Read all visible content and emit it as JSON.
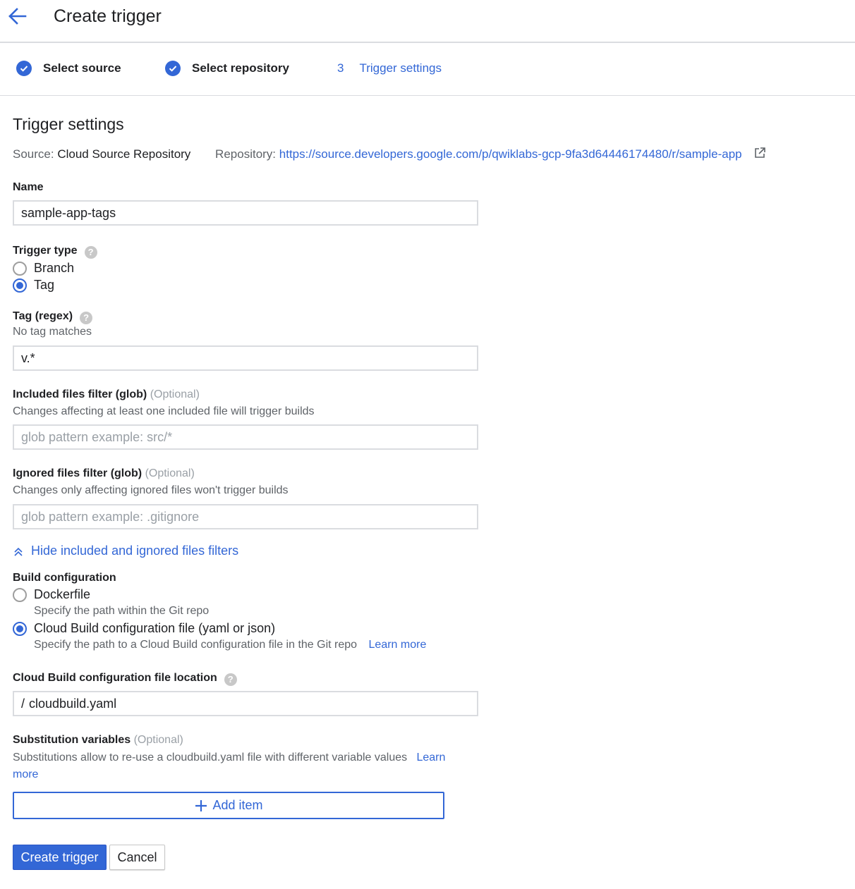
{
  "header": {
    "back_icon": "arrow-back-icon",
    "title": "Create trigger"
  },
  "stepper": {
    "steps": [
      {
        "label": "Select source",
        "state": "complete"
      },
      {
        "label": "Select repository",
        "state": "complete"
      },
      {
        "number": "3",
        "label": "Trigger settings",
        "state": "active"
      }
    ]
  },
  "settings": {
    "title": "Trigger settings",
    "source_label": "Source:",
    "source_value": "Cloud Source Repository",
    "repository_label": "Repository:",
    "repository_url": "https://source.developers.google.com/p/qwiklabs-gcp-9fa3d64446174480/r/sample-app"
  },
  "name": {
    "label": "Name",
    "value": "sample-app-tags"
  },
  "trigger_type": {
    "label": "Trigger type",
    "options": [
      {
        "label": "Branch",
        "selected": false
      },
      {
        "label": "Tag",
        "selected": true
      }
    ]
  },
  "tag": {
    "label": "Tag (regex)",
    "hint": "No tag matches",
    "value": "v.*"
  },
  "included_filter": {
    "label": "Included files filter (glob)",
    "optional": "(Optional)",
    "hint": "Changes affecting at least one included file will trigger builds",
    "placeholder": "glob pattern example: src/*"
  },
  "ignored_filter": {
    "label": "Ignored files filter (glob)",
    "optional": "(Optional)",
    "hint": "Changes only affecting ignored files won't trigger builds",
    "placeholder": "glob pattern example: .gitignore"
  },
  "toggle_filters": {
    "label": "Hide included and ignored files filters"
  },
  "build_config": {
    "label": "Build configuration",
    "options": [
      {
        "label": "Dockerfile",
        "hint": "Specify the path within the Git repo",
        "selected": false
      },
      {
        "label": "Cloud Build configuration file (yaml or json)",
        "hint": "Specify the path to a Cloud Build configuration file in the Git repo",
        "link": "Learn more",
        "selected": true
      }
    ]
  },
  "config_location": {
    "label": "Cloud Build configuration file location",
    "prefix": "/",
    "value": "cloudbuild.yaml"
  },
  "substitutions": {
    "label": "Substitution variables",
    "optional": "(Optional)",
    "hint": "Substitutions allow to re-use a cloudbuild.yaml file with different variable values",
    "link": "Learn more",
    "add_label": "Add item"
  },
  "actions": {
    "create_label": "Create trigger",
    "cancel_label": "Cancel"
  },
  "colors": {
    "accent": "#3367d6",
    "text": "#202124",
    "muted": "#5f6368",
    "border": "#dadce0"
  }
}
